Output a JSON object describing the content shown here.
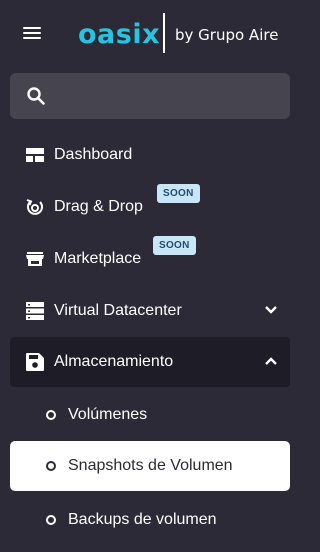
{
  "header": {
    "brand": "oasix",
    "tagline": "by Grupo Aire"
  },
  "search": {
    "placeholder": ""
  },
  "nav": {
    "items": [
      {
        "label": "Dashboard",
        "icon": "dashboard-icon"
      },
      {
        "label": "Drag & Drop",
        "icon": "drag-drop-icon",
        "badge": "SOON"
      },
      {
        "label": "Marketplace",
        "icon": "store-icon",
        "badge": "SOON"
      },
      {
        "label": "Virtual Datacenter",
        "icon": "server-icon",
        "expanded": false
      },
      {
        "label": "Almacenamiento",
        "icon": "save-icon",
        "expanded": true
      }
    ],
    "sub_items": [
      {
        "label": "Volúmenes",
        "active": false
      },
      {
        "label": "Snapshots de Volumen",
        "active": true
      },
      {
        "label": "Backups de volumen",
        "active": false
      }
    ]
  },
  "colors": {
    "background": "#2b2a36",
    "accent": "#29c3e0",
    "badge_bg": "#c8e6f6",
    "badge_text": "#1b4f6e",
    "search_bg": "#46454f",
    "expanded_bg": "#1e1d27"
  }
}
